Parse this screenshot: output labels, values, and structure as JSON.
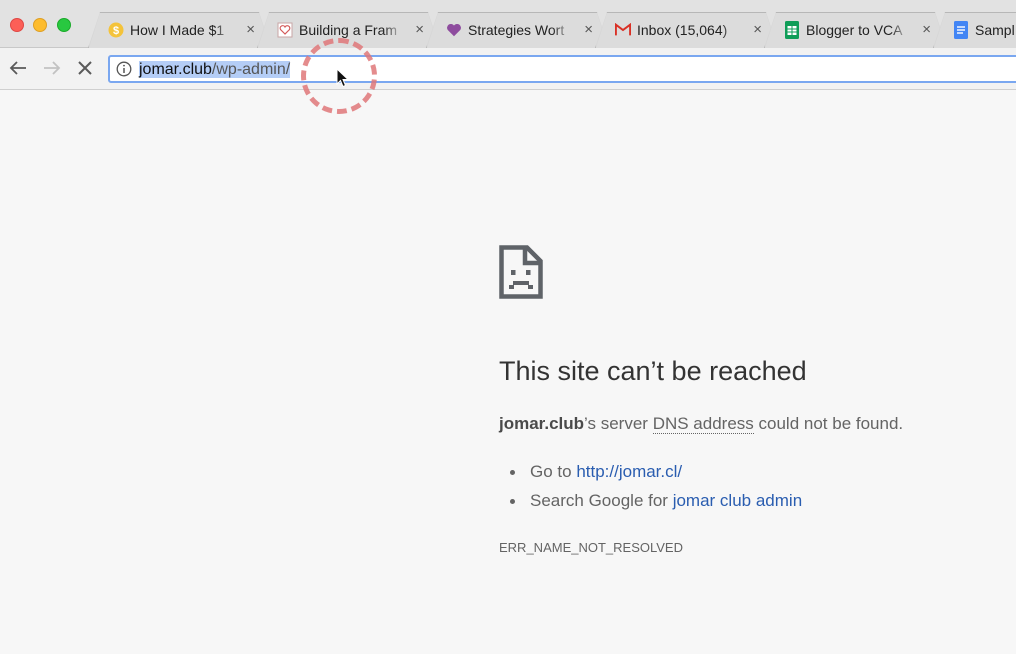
{
  "tabs": [
    {
      "title": "How I Made $1",
      "favicon": "dollar-coin-icon"
    },
    {
      "title": "Building a Fram",
      "favicon": "heart-icon"
    },
    {
      "title": "Strategies Wort",
      "favicon": "purple-heart-icon"
    },
    {
      "title": "Inbox (15,064)",
      "favicon": "gmail-icon"
    },
    {
      "title": "Blogger to VCA",
      "favicon": "sheets-icon"
    },
    {
      "title": "Sampl",
      "favicon": "docs-icon"
    }
  ],
  "tab_close_glyph": "×",
  "omnibox": {
    "host": "jomar.club",
    "path": "/wp-admin/"
  },
  "error": {
    "title": "This site can’t be reached",
    "host_bold": "jomar.club",
    "desc_part1": "’s server ",
    "desc_abbr": "DNS address",
    "desc_part2": " could not be found.",
    "suggest1_prefix": "Go to ",
    "suggest1_link": "http://jomar.cl/",
    "suggest2_prefix": "Search Google for ",
    "suggest2_link": "jomar club admin",
    "code": "ERR_NAME_NOT_RESOLVED"
  },
  "colors": {
    "link": "#2a5db0",
    "omnibox_focus": "#7aa7f0",
    "selection": "#b4cdf6",
    "click_ring": "#e0787a"
  }
}
